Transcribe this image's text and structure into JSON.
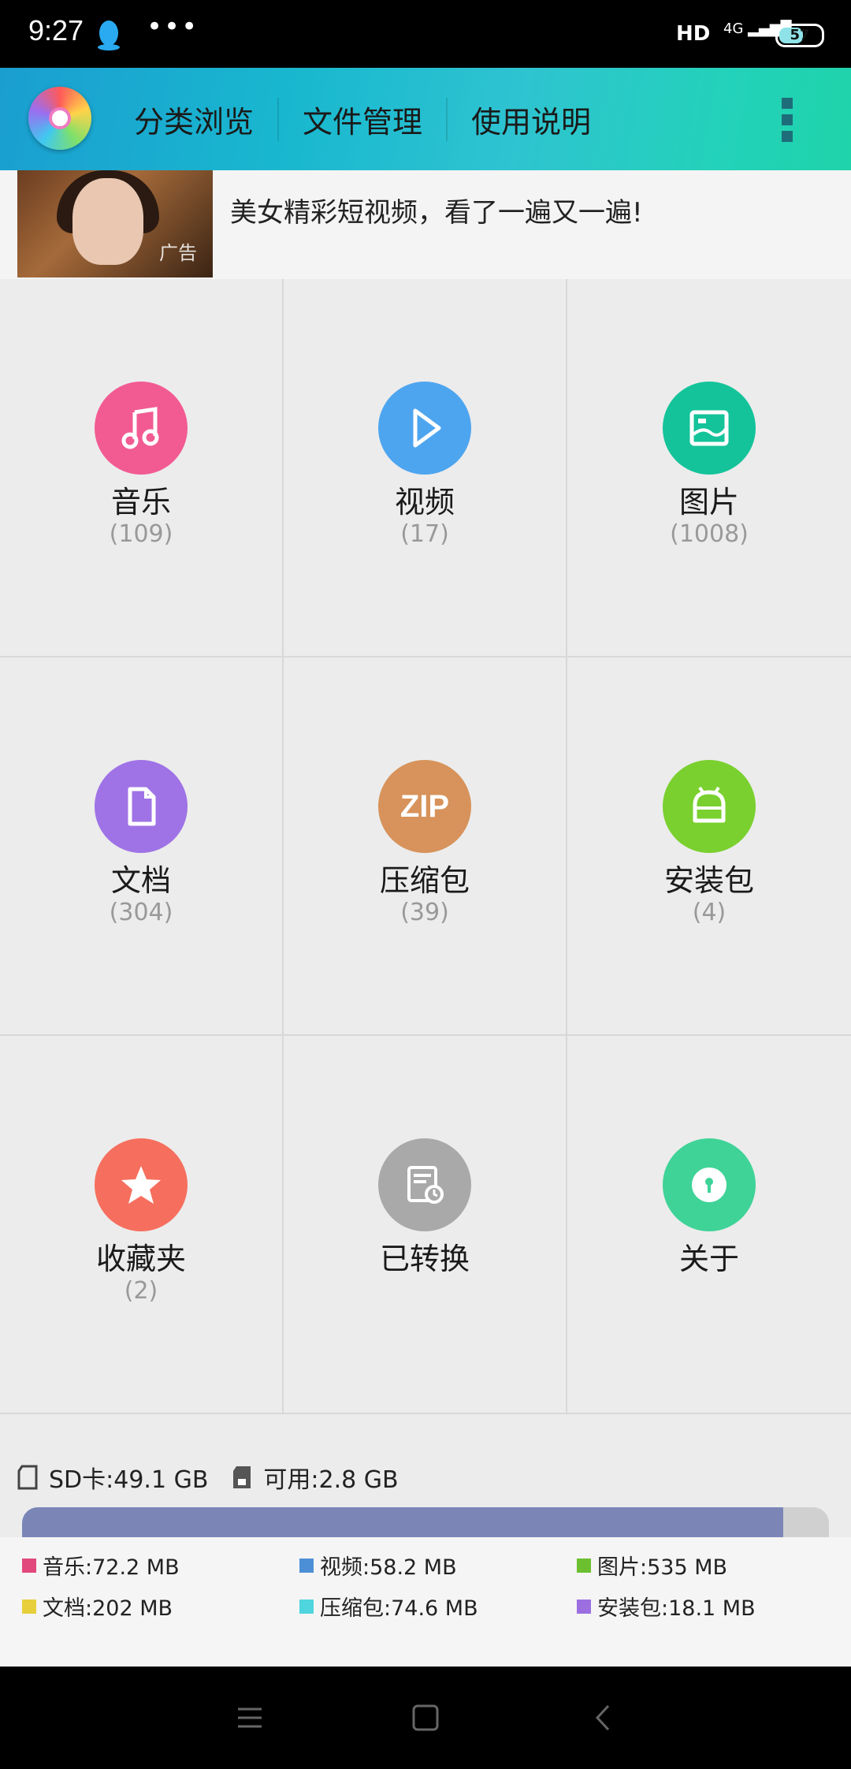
{
  "status_bar": {
    "time": "9:27",
    "network": "HD",
    "signal": "4G",
    "battery": "57"
  },
  "header": {
    "tabs": [
      "分类浏览",
      "文件管理",
      "使用说明"
    ]
  },
  "ad": {
    "title": "美女精彩短视频，看了一遍又一遍!",
    "tag": "广告"
  },
  "categories": [
    {
      "label": "音乐",
      "count": "(109)",
      "color": "#f25b92",
      "icon": "music-note-icon"
    },
    {
      "label": "视频",
      "count": "(17)",
      "color": "#4ea5ef",
      "icon": "play-icon"
    },
    {
      "label": "图片",
      "count": "(1008)",
      "color": "#14c39a",
      "icon": "image-icon"
    },
    {
      "label": "文档",
      "count": "(304)",
      "color": "#9f73e6",
      "icon": "document-icon"
    },
    {
      "label": "压缩包",
      "count": "(39)",
      "color": "#d7935b",
      "icon": "zip-icon"
    },
    {
      "label": "安装包",
      "count": "(4)",
      "color": "#7ad02f",
      "icon": "android-icon"
    },
    {
      "label": "收藏夹",
      "count": "(2)",
      "color": "#f66f5e",
      "icon": "star-icon"
    },
    {
      "label": "已转换",
      "count": "",
      "color": "#a9a9a9",
      "icon": "converted-icon"
    },
    {
      "label": "关于",
      "count": "",
      "color": "#3fd397",
      "icon": "info-icon"
    }
  ],
  "storage": {
    "sd_card": "SD卡:49.1 GB",
    "available": "可用:2.8 GB",
    "used_fraction": 0.943
  },
  "legend": [
    {
      "label": "音乐:72.2 MB",
      "color": "#e1497c"
    },
    {
      "label": "视频:58.2 MB",
      "color": "#4d8fd6"
    },
    {
      "label": "图片:535 MB",
      "color": "#6cbf2f"
    },
    {
      "label": "文档:202 MB",
      "color": "#e6cf3b"
    },
    {
      "label": "压缩包:74.6 MB",
      "color": "#4fd5de"
    },
    {
      "label": "安装包:18.1 MB",
      "color": "#9c6fe0"
    }
  ]
}
